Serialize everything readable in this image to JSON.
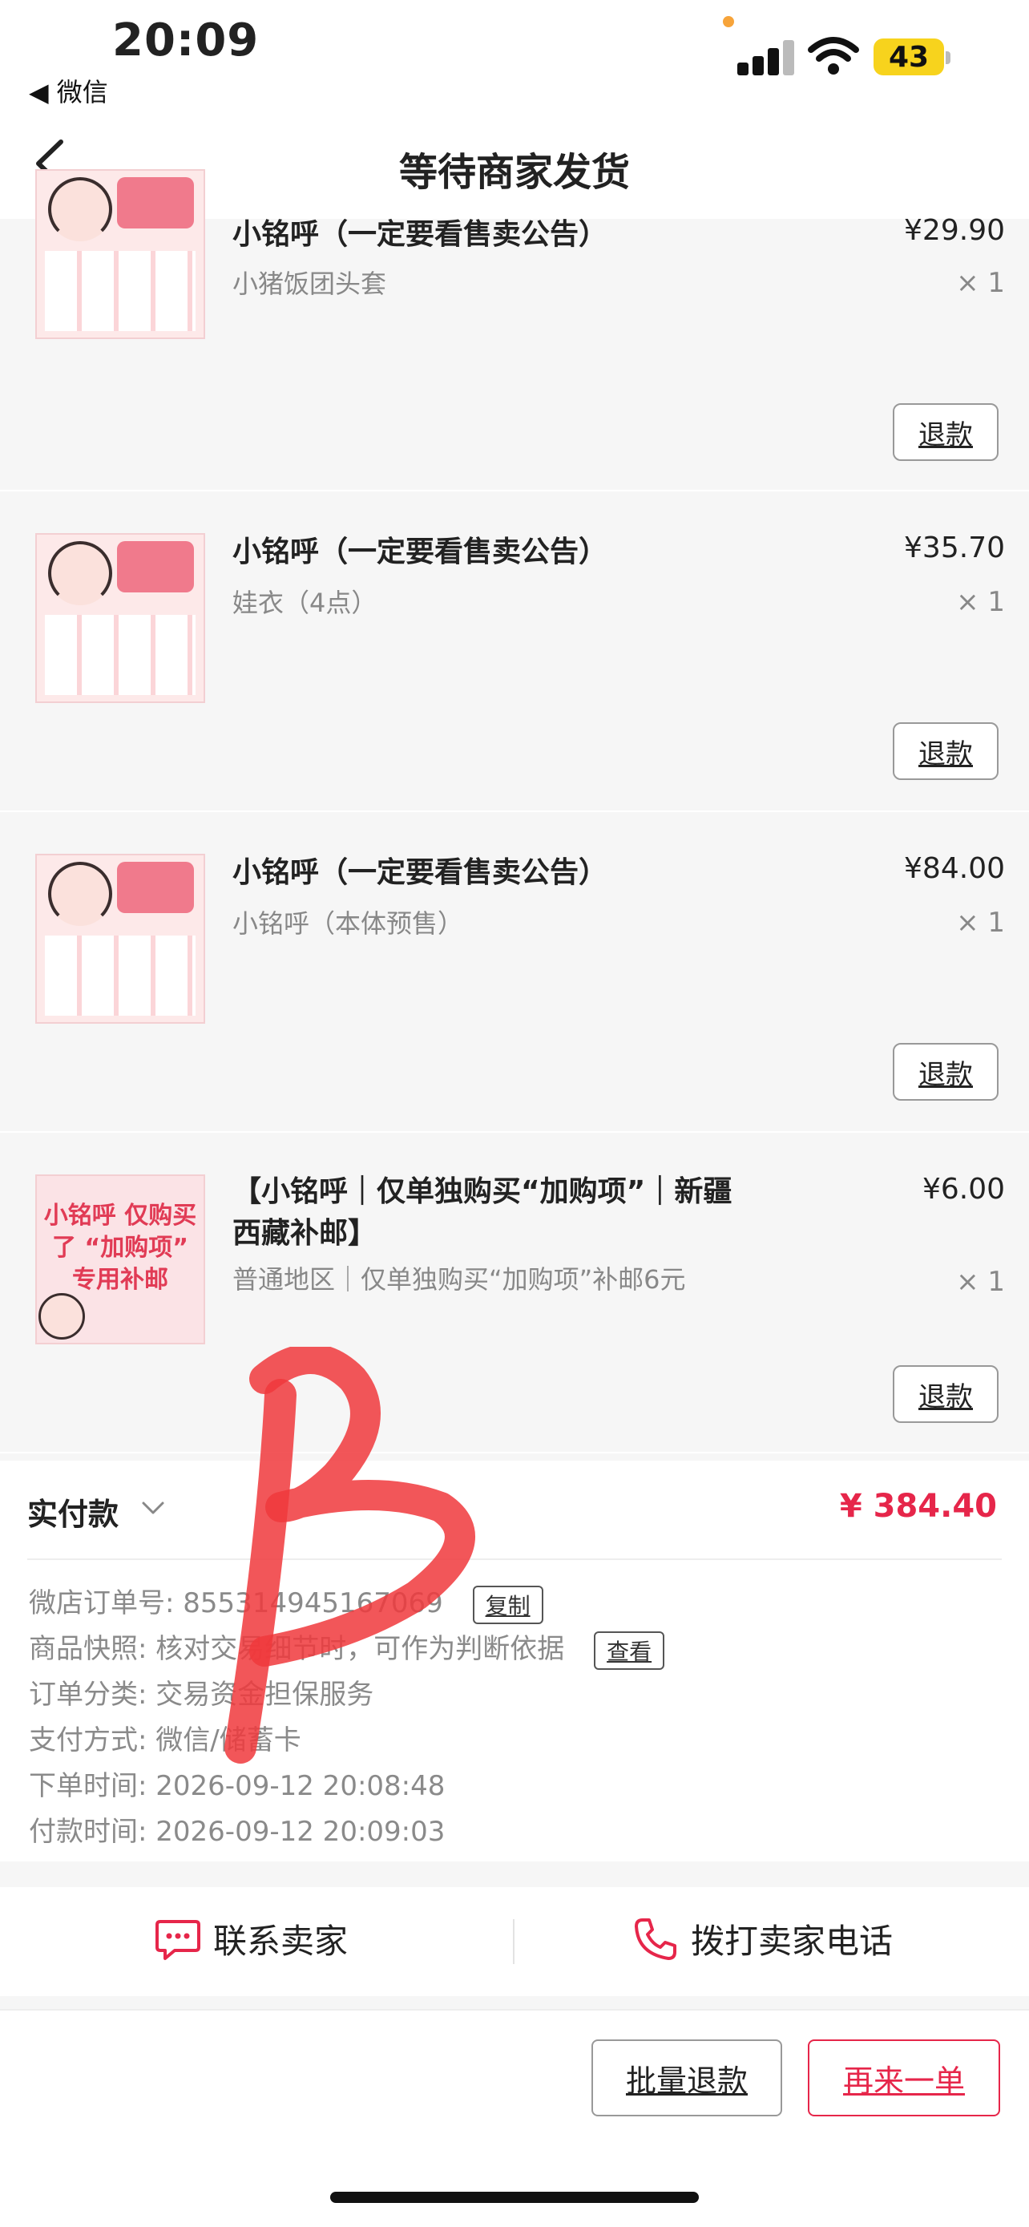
{
  "status_bar": {
    "time": "20:09",
    "back_app": "◀ 微信",
    "battery": "43"
  },
  "nav": {
    "title": "等待商家发货"
  },
  "items": [
    {
      "title": "小铭呼（一定要看售卖公告）",
      "sku": "小猪饭团头套",
      "price": "¥29.90",
      "qty": "× 1",
      "refund_label": "退款"
    },
    {
      "title": "小铭呼（一定要看售卖公告）",
      "sku": "娃衣（4点）",
      "price": "¥35.70",
      "qty": "× 1",
      "refund_label": "退款"
    },
    {
      "title": "小铭呼（一定要看售卖公告）",
      "sku": "小铭呼（本体预售）",
      "price": "¥84.00",
      "qty": "× 1",
      "refund_label": "退款"
    },
    {
      "title": "【小铭呼｜仅单独购买“加购项”｜新疆西藏补邮】",
      "sku": "普通地区｜仅单独购买“加购项”补邮6元",
      "price": "¥6.00",
      "qty": "× 1",
      "refund_label": "退款",
      "thumb_text": "小铭呼 仅购买了 “加购项” 专用补邮"
    }
  ],
  "payment": {
    "label": "实付款",
    "amount": "¥ 384.40",
    "order_no_label": "微店订单号:",
    "order_no": "855314945167069",
    "copy_label": "复制",
    "snapshot_label": "商品快照:",
    "snapshot_text": "核对交易细节时，可作为判断依据",
    "view_label": "查看",
    "category_label": "订单分类:",
    "category": "交易资金担保服务",
    "method_label": "支付方式:",
    "method": "微信/储蓄卡",
    "order_time_label": "下单时间:",
    "order_time": "2026-09-12 20:08:48",
    "pay_time_label": "付款时间:",
    "pay_time": "2026-09-12 20:09:03"
  },
  "contact": {
    "seller": "联系卖家",
    "phone": "拨打卖家电话"
  },
  "bottom": {
    "batch_refund": "批量退款",
    "buy_again": "再来一单"
  },
  "colors": {
    "accent": "#e6264a",
    "scribble": "#f0383c"
  }
}
